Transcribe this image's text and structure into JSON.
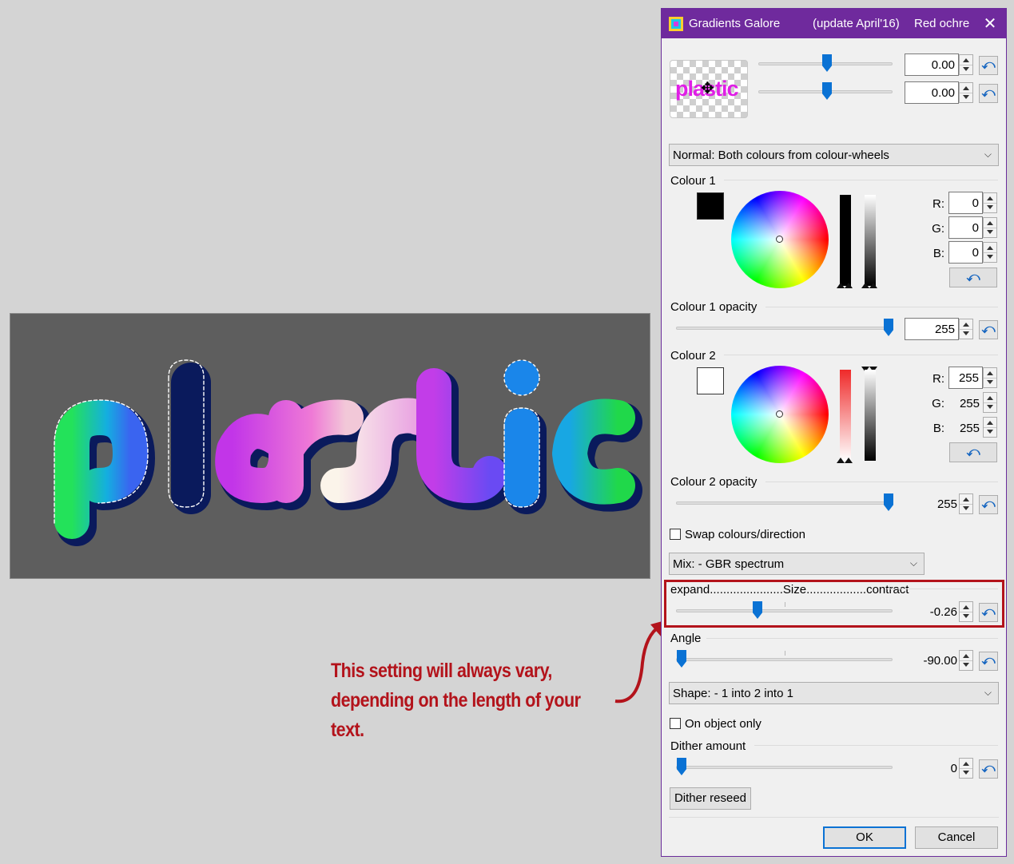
{
  "canvas": {
    "text": "plastic",
    "background_color": "#5e5e5e"
  },
  "callout": {
    "line1": "This setting will always vary,",
    "line2": "depending on the length of your text.",
    "color": "#b3131b"
  },
  "dialog": {
    "title": "Gradients Galore",
    "update": "(update April'16)",
    "preset": "Red ochre",
    "preview_text": "plastic",
    "offset_x": {
      "value": "0.00",
      "level": 0.5
    },
    "offset_y": {
      "value": "0.00",
      "level": 0.5
    },
    "mode_select": "Normal: Both colours from colour-wheels",
    "colour1": {
      "label": "Colour 1",
      "swatch": "#000000",
      "r_label": "R:",
      "g_label": "G:",
      "b_label": "B:",
      "r": "0",
      "g": "0",
      "b": "0"
    },
    "colour1_opacity": {
      "label": "Colour 1 opacity",
      "value": "255",
      "level": 1.0
    },
    "colour2": {
      "label": "Colour 2",
      "swatch": "#ffffff",
      "r_label": "R:",
      "g_label": "G:",
      "b_label": "B:",
      "r": "255",
      "g": "255",
      "b": "255"
    },
    "colour2_opacity": {
      "label": "Colour 2 opacity",
      "value": "255",
      "level": 1.0
    },
    "swap_label": "Swap colours/direction",
    "mix_select": "Mix: - GBR spectrum",
    "size": {
      "label": "expand......................Size..................contract",
      "value": "-0.26",
      "level": 0.37
    },
    "angle": {
      "label": "Angle",
      "value": "-90.00",
      "level": 0.0
    },
    "shape_select": "Shape: - 1 into 2 into 1",
    "on_object_label": "On object only",
    "dither": {
      "label": "Dither amount",
      "value": "0",
      "level": 0.0
    },
    "dither_reseed": "Dither reseed",
    "ok": "OK",
    "cancel": "Cancel",
    "accent_color": "#0a72d4",
    "title_bar_color": "#6f2a9d"
  }
}
